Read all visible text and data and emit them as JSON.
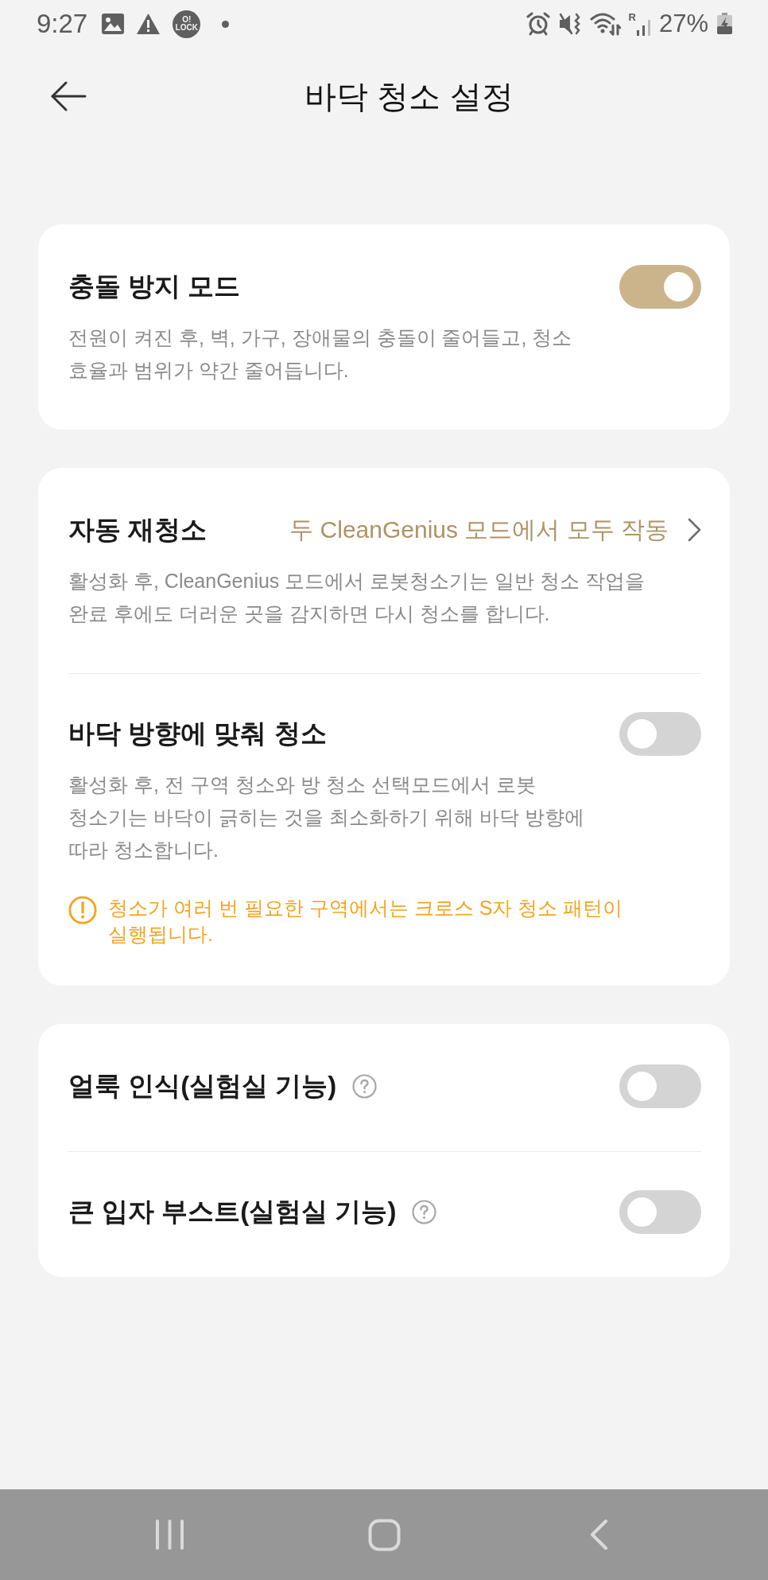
{
  "status_bar": {
    "time": "9:27",
    "app_badge": [
      "O!",
      "LOCK"
    ],
    "roaming_label": "R",
    "battery": "27%"
  },
  "header": {
    "title": "바닥 청소 설정"
  },
  "cards": [
    {
      "items": [
        {
          "kind": "toggle",
          "title": "충돌 방지 모드",
          "on": true,
          "description": "전원이 켜진 후, 벽, 가구, 장애물의 충돌이 줄어들고, 청소 효율과 범위가 약간 줄어듭니다."
        }
      ]
    },
    {
      "items": [
        {
          "kind": "link",
          "title": "자동 재청소",
          "value": "두 CleanGenius 모드에서 모두 작동",
          "description": "활성화 후, CleanGenius 모드에서 로봇청소기는 일반 청소 작업을 완료 후에도 더러운 곳을 감지하면 다시 청소를 합니다."
        },
        {
          "kind": "toggle",
          "title": "바닥 방향에 맞춰 청소",
          "on": false,
          "description": "활성화 후, 전 구역 청소와 방 청소 선택모드에서 로봇 청소기는 바닥이 긁히는 것을 최소화하기 위해 바닥 방향에 따라 청소합니다.",
          "warning": "청소가 여러 번 필요한 구역에서는 크로스 S자 청소 패턴이 실행됩니다."
        }
      ]
    },
    {
      "items": [
        {
          "kind": "toggle",
          "title": "얼룩 인식(실험실 기능)",
          "on": false,
          "help": true
        },
        {
          "kind": "toggle",
          "title": "큰 입자 부스트(실험실 기능)",
          "on": false,
          "help": true
        }
      ]
    }
  ]
}
